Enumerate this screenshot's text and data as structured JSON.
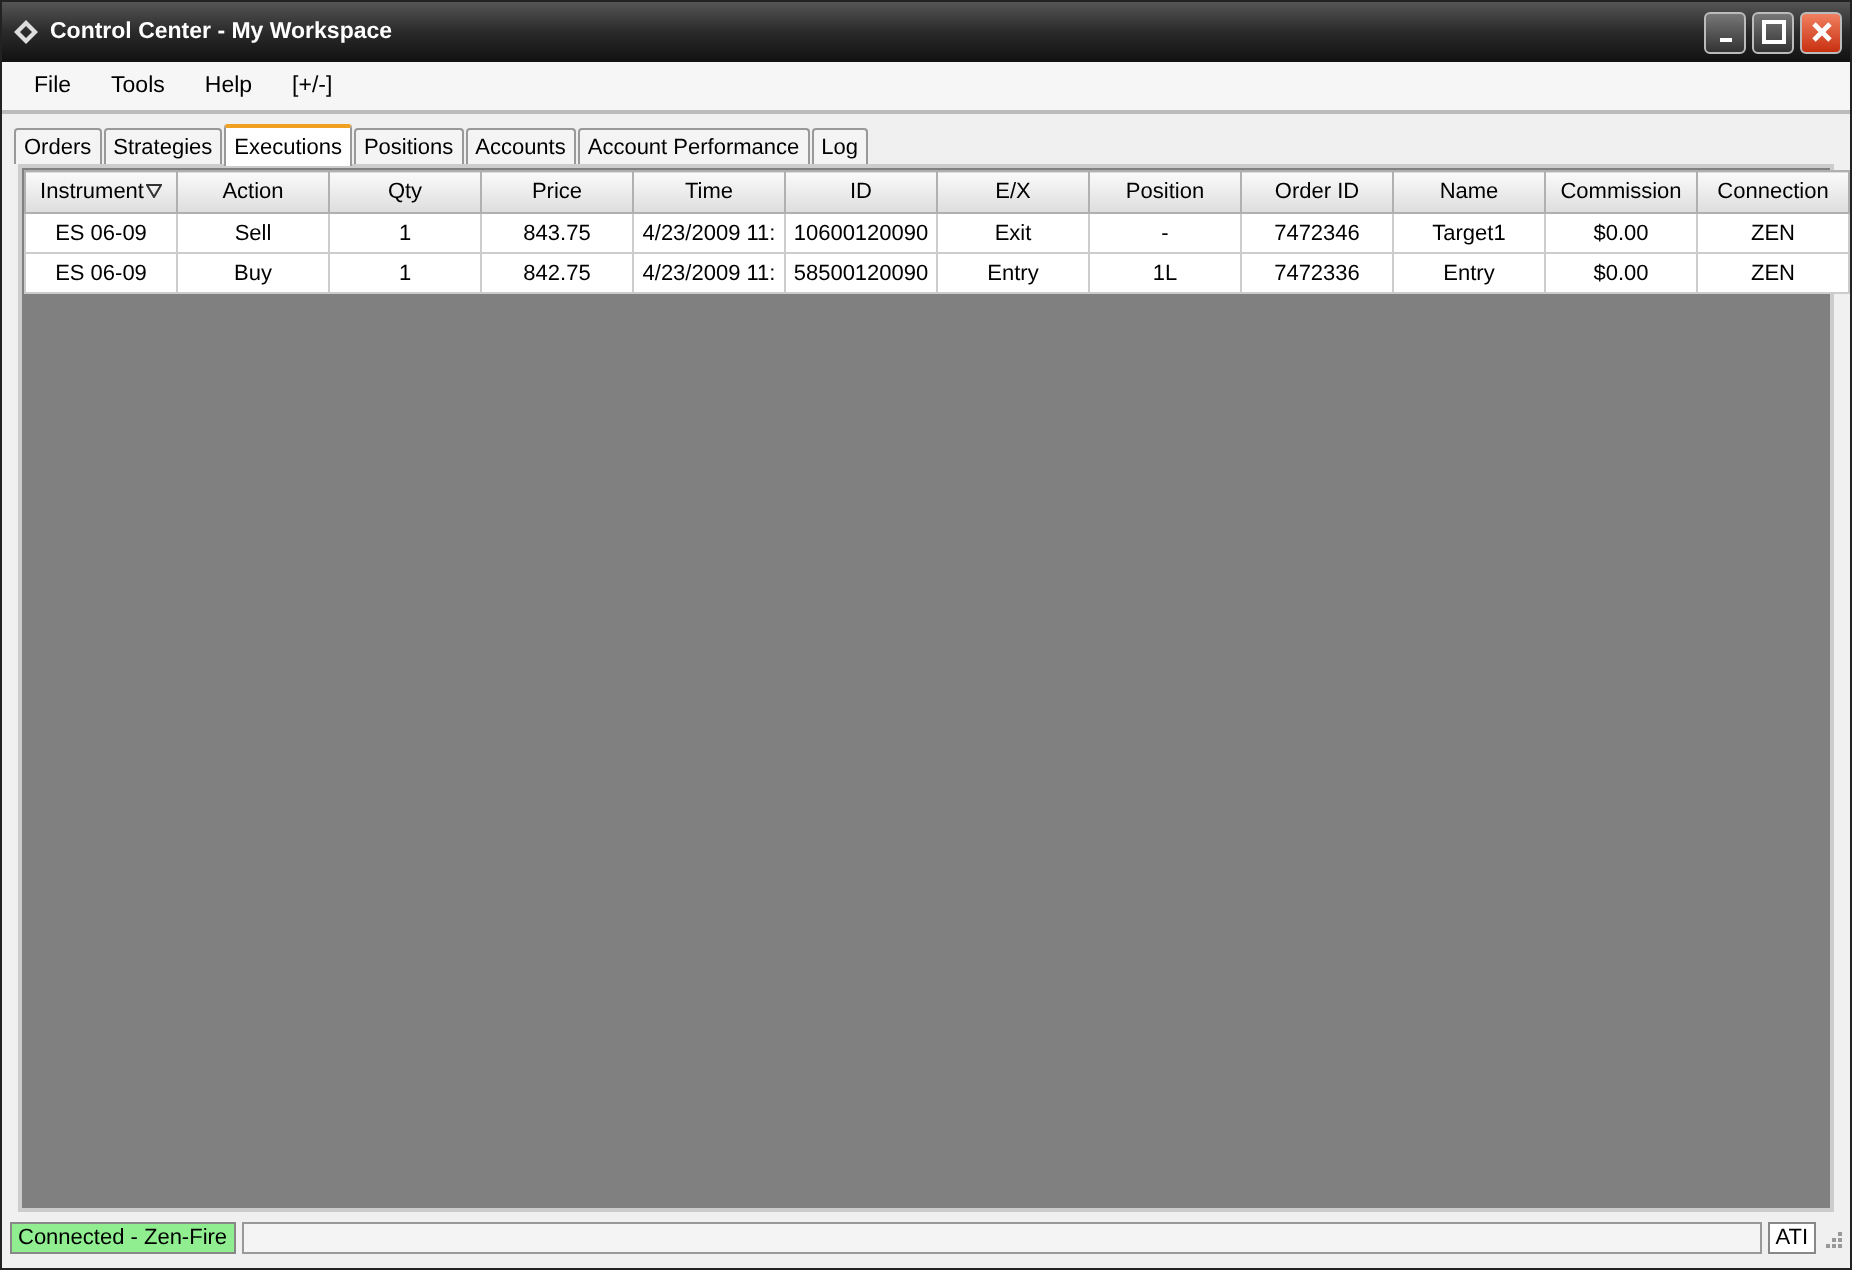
{
  "window": {
    "title": "Control Center - My Workspace"
  },
  "menu": [
    "File",
    "Tools",
    "Help",
    "[+/-]"
  ],
  "tabs": [
    {
      "label": "Orders",
      "selected": false
    },
    {
      "label": "Strategies",
      "selected": false
    },
    {
      "label": "Executions",
      "selected": true
    },
    {
      "label": "Positions",
      "selected": false
    },
    {
      "label": "Accounts",
      "selected": false
    },
    {
      "label": "Account Performance",
      "selected": false
    },
    {
      "label": "Log",
      "selected": false
    }
  ],
  "table": {
    "columns": [
      {
        "label": "Instrument",
        "sorted": true
      },
      {
        "label": "Action"
      },
      {
        "label": "Qty"
      },
      {
        "label": "Price"
      },
      {
        "label": "Time"
      },
      {
        "label": "ID"
      },
      {
        "label": "E/X"
      },
      {
        "label": "Position"
      },
      {
        "label": "Order ID"
      },
      {
        "label": "Name"
      },
      {
        "label": "Commission"
      },
      {
        "label": "Connection"
      }
    ],
    "rows": [
      [
        "ES 06-09",
        "Sell",
        "1",
        "843.75",
        "4/23/2009 11:",
        "10600120090",
        "Exit",
        "-",
        "7472346",
        "Target1",
        "$0.00",
        "ZEN"
      ],
      [
        "ES 06-09",
        "Buy",
        "1",
        "842.75",
        "4/23/2009 11:",
        "58500120090",
        "Entry",
        "1L",
        "7472336",
        "Entry",
        "$0.00",
        "ZEN"
      ]
    ]
  },
  "status_bar": {
    "connection": {
      "text": "Connected - Zen-Fire",
      "connected": true
    },
    "account": "ATI"
  }
}
